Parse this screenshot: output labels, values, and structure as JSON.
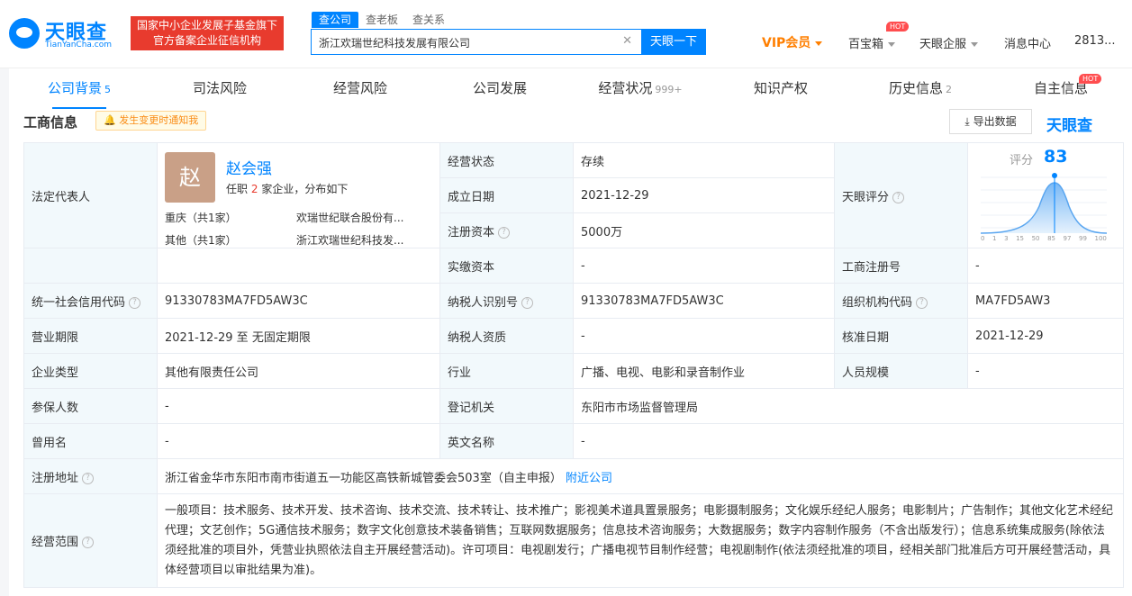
{
  "header": {
    "logo_text": "天眼查",
    "logo_sub": "TianYanCha.com",
    "badge_line1": "国家中小企业发展子基金旗下",
    "badge_line2": "官方备案企业征信机构",
    "search_tabs": [
      "查公司",
      "查老板",
      "查关系"
    ],
    "search_value": "浙江欢瑞世纪科技发展有限公司",
    "search_button": "天眼一下",
    "vip": "VIP会员",
    "box": "百宝箱",
    "hot": "HOT",
    "enterprise": "天眼企服",
    "messages": "消息中心",
    "user": "2813..."
  },
  "tabs": [
    {
      "label": "公司背景",
      "count": "5"
    },
    {
      "label": "司法风险",
      "count": ""
    },
    {
      "label": "经营风险",
      "count": ""
    },
    {
      "label": "公司发展",
      "count": ""
    },
    {
      "label": "经营状况",
      "count": "999+"
    },
    {
      "label": "知识产权",
      "count": ""
    },
    {
      "label": "历史信息",
      "count": "2"
    },
    {
      "label": "自主信息",
      "count": ""
    }
  ],
  "section": {
    "title": "工商信息",
    "notify": "发生变更时通知我",
    "export": "导出数据",
    "watermark": "天眼查"
  },
  "legal": {
    "label": "法定代表人",
    "avatar": "赵",
    "name": "赵会强",
    "role_prefix": "任职",
    "role_count": "2",
    "role_suffix": "家企业，分布如下",
    "region1": "重庆（共1家）",
    "company1": "欢瑞世纪联合股份有...",
    "region2": "其他（共1家）",
    "company2": "浙江欢瑞世纪科技发..."
  },
  "fields": {
    "status_k": "经营状态",
    "status_v": "存续",
    "est_k": "成立日期",
    "est_v": "2021-12-29",
    "cap_k": "注册资本",
    "cap_v": "5000万",
    "paid_k": "实缴资本",
    "paid_v": "-",
    "score_k": "天眼评分",
    "reg_no_k": "工商注册号",
    "reg_no_v": "-",
    "uscc_k": "统一社会信用代码",
    "uscc_v": "91330783MA7FD5AW3C",
    "tax_k": "纳税人识别号",
    "tax_v": "91330783MA7FD5AW3C",
    "org_k": "组织机构代码",
    "org_v": "MA7FD5AW3",
    "term_k": "营业期限",
    "term_v": "2021-12-29  至 无固定期限",
    "taxq_k": "纳税人资质",
    "taxq_v": "-",
    "approve_k": "核准日期",
    "approve_v": "2021-12-29",
    "type_k": "企业类型",
    "type_v": "其他有限责任公司",
    "ind_k": "行业",
    "ind_v": "广播、电视、电影和录音制作业",
    "staff_k": "人员规模",
    "staff_v": "-",
    "ins_k": "参保人数",
    "ins_v": "-",
    "auth_k": "登记机关",
    "auth_v": "东阳市市场监督管理局",
    "former_k": "曾用名",
    "former_v": "-",
    "en_k": "英文名称",
    "en_v": "-",
    "addr_k": "注册地址",
    "addr_v": "浙江省金华市东阳市南市街道五一功能区高铁新城管委会503室（自主申报）",
    "addr_link": "附近公司",
    "scope_k": "经营范围",
    "scope_v": "一般项目：技术服务、技术开发、技术咨询、技术交流、技术转让、技术推广；影视美术道具置景服务；电影摄制服务；文化娱乐经纪人服务；电影制片；广告制作；其他文化艺术经纪代理；文艺创作；5G通信技术服务；数字文化创意技术装备销售；互联网数据服务；信息技术咨询服务；大数据服务；数字内容制作服务（不含出版发行）；信息系统集成服务(除依法须经批准的项目外，凭营业执照依法自主开展经营活动)。许可项目：电视剧发行；广播电视节目制作经营；电视剧制作(依法须经批准的项目，经相关部门批准后方可开展经营活动，具体经营项目以审批结果为准)。"
  },
  "score": {
    "label": "评分",
    "value": "83",
    "axis": [
      "0",
      "1",
      "3",
      "15",
      "50",
      "85",
      "97",
      "99",
      "100"
    ]
  },
  "colors": {
    "accent": "#0084ff",
    "red": "#e83b2e",
    "vip": "#ff7f00"
  }
}
